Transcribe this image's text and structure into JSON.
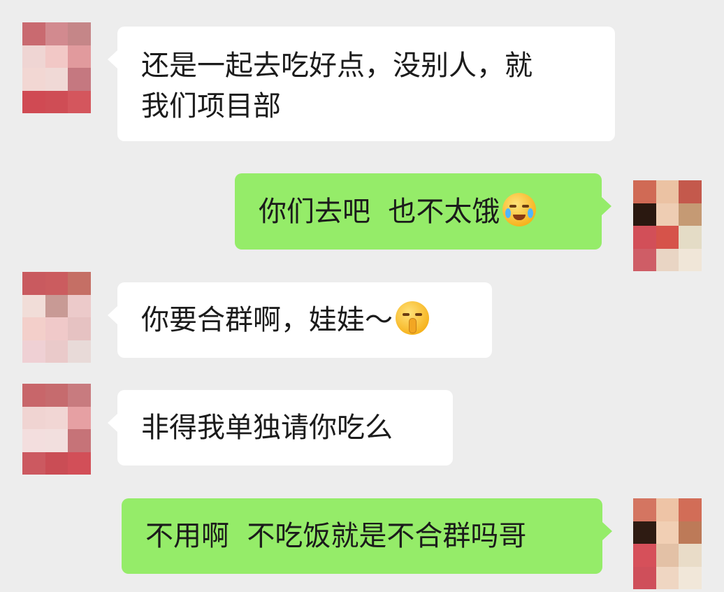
{
  "messages": [
    {
      "side": "in",
      "text": "还是一起去吃好点，没别人，就我们项目部",
      "line1": "还是一起去吃好点，没别人，就",
      "line2": "我们项目部"
    },
    {
      "side": "out",
      "text": "你们去吧  也不太饿",
      "emoji": "loudly-crying-face-icon"
    },
    {
      "side": "in",
      "text": "你要合群啊，娃娃～",
      "emoji": "shushing-face-icon"
    },
    {
      "side": "in",
      "text": "非得我单独请你吃么"
    },
    {
      "side": "out",
      "text": "不用啊  不吃饭就是不合群吗哥"
    }
  ],
  "colors": {
    "background": "#ededed",
    "incoming_bubble": "#ffffff",
    "outgoing_bubble": "#95ec69",
    "text": "#1b1b1b"
  },
  "avatars": {
    "contact": [
      "#f0d9d6",
      "#f3e1dc",
      "#ecd7d2",
      "#d6969a",
      "#f5cfcf",
      "#dd8a8c",
      "#f4dfdb",
      "#c79b9c",
      "#f0cacb",
      "#c9545c",
      "#cc5860",
      "#d0636a"
    ],
    "contact_b": [
      "#c95a5f",
      "#cb5c5f",
      "#c56f65",
      "#f1ddd8",
      "#c89a95",
      "#eccaca",
      "#f3cfca",
      "#f0c9c9",
      "#e6c2c2",
      "#efd0d4",
      "#eacaca",
      "#e8dad8"
    ],
    "contact_c": [
      "#c96a70",
      "#d28a8f",
      "#c58688",
      "#efd5d3",
      "#f2c8c6",
      "#e19a9d",
      "#f2d7d3",
      "#f0d9d6",
      "#c57880",
      "#d04a53",
      "#cf4d55",
      "#d4565d"
    ],
    "contact_d": [
      "#c8666a",
      "#c66b6e",
      "#c87b7f",
      "#f0d4d2",
      "#f1d6d4",
      "#e6a0a3",
      "#f3dede",
      "#f2dfde",
      "#c67378",
      "#cc5960",
      "#ca4d55",
      "#d24f58"
    ],
    "self": [
      "#d06a55",
      "#ebc2a3",
      "#c4594c",
      "#2a1810",
      "#eecdb3",
      "#c59a74",
      "#d24f58",
      "#d6534a",
      "#e4dcc6",
      "#cf5d66",
      "#e9d5c4",
      "#f0e6d8"
    ],
    "self_b": [
      "#d47561",
      "#eec4a6",
      "#d26d57",
      "#2e1b12",
      "#f1cfb4",
      "#bd7a58",
      "#d6505a",
      "#e3c1a6",
      "#e9dcc8",
      "#cf4f5a",
      "#efd6c2",
      "#f1e7d9"
    ]
  }
}
